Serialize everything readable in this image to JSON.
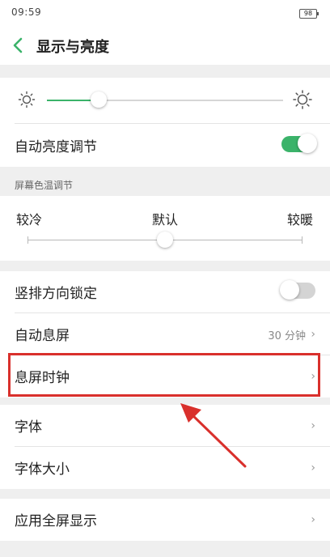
{
  "status_bar": {
    "time": "09:59",
    "battery": "98"
  },
  "header": {
    "title": "显示与亮度"
  },
  "brightness": {
    "level": 0.22
  },
  "auto_brightness": {
    "label": "自动亮度调节",
    "enabled": true
  },
  "color_temp": {
    "caption": "屏幕色温调节",
    "left_label": "较冷",
    "mid_label": "默认",
    "right_label": "较暖",
    "level": 0.5
  },
  "settings": {
    "portrait_lock": {
      "label": "竖排方向锁定",
      "enabled": false
    },
    "auto_sleep": {
      "label": "自动息屏",
      "value": "30 分钟"
    },
    "sleep_clock": {
      "label": "息屏时钟"
    },
    "font": {
      "label": "字体"
    },
    "font_size": {
      "label": "字体大小"
    },
    "fullscreen": {
      "label": "应用全屏显示"
    }
  },
  "colors": {
    "accent": "#3bb36a",
    "highlight_border": "#d9302c"
  }
}
